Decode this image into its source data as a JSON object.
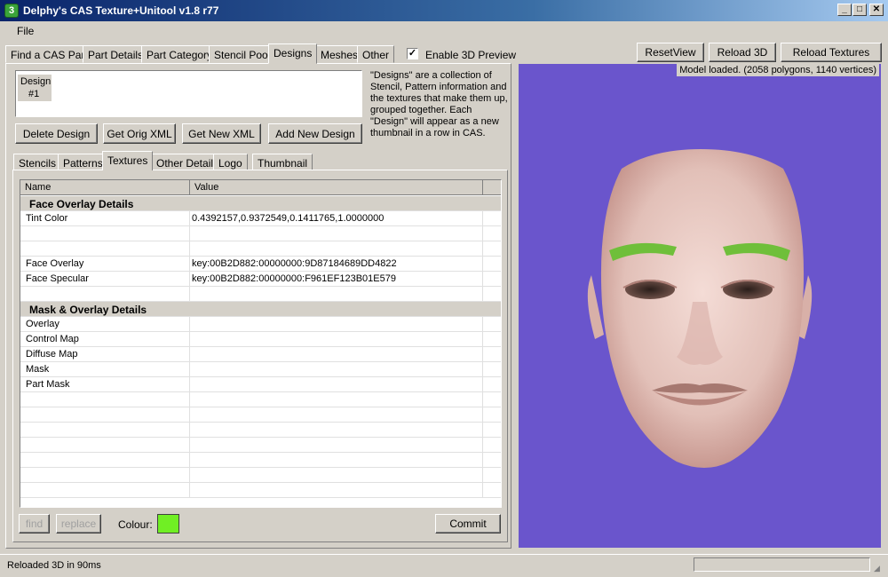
{
  "window": {
    "title": "Delphy's CAS Texture+Unitool v1.8 r77",
    "icon_glyph": "3",
    "controls": {
      "minimize": "_",
      "maximize": "□",
      "close": "✕"
    }
  },
  "menu": {
    "file": "File"
  },
  "main_tabs": [
    "Find a CAS Part",
    "Part Details",
    "Part Category",
    "Stencil Pool",
    "Designs",
    "Meshes",
    "Other"
  ],
  "enable_3d": {
    "label": "Enable 3D Preview",
    "checked": true,
    "check_glyph": "✓"
  },
  "toolbar_3d": {
    "reset_view": "ResetView",
    "reload_3d": "Reload 3D",
    "reload_textures": "Reload Textures"
  },
  "model_status": "Model loaded.  (2058 polygons, 1140 vertices)",
  "design_list": {
    "label": "Design",
    "item": "#1"
  },
  "design_help": "\"Designs\" are a collection of Stencil, Pattern information and the textures that make them up, grouped together.  Each \"Design\" will appear as a new thumbnail in a row in CAS.",
  "design_buttons": {
    "delete": "Delete Design",
    "get_orig": "Get Orig XML",
    "get_new": "Get New XML",
    "add_new": "Add New Design"
  },
  "sub_tabs": [
    "Stencils",
    "Patterns",
    "Textures",
    "Other Details",
    "Logo",
    "Thumbnail"
  ],
  "grid": {
    "headers": {
      "name": "Name",
      "value": "Value"
    },
    "category_1": "Face Overlay Details",
    "tint_color": {
      "name": "Tint Color",
      "value": "0.4392157,0.9372549,0.1411765,1.0000000"
    },
    "face_overlay": {
      "name": "Face Overlay",
      "value": "key:00B2D882:00000000:9D87184689DD4822"
    },
    "face_specular": {
      "name": "Face Specular",
      "value": "key:00B2D882:00000000:F961EF123B01E579"
    },
    "category_2": "Mask & Overlay Details",
    "overlay": {
      "name": "Overlay",
      "value": ""
    },
    "control_map": {
      "name": "Control Map",
      "value": ""
    },
    "diffuse_map": {
      "name": "Diffuse Map",
      "value": ""
    },
    "mask": {
      "name": "Mask",
      "value": ""
    },
    "part_mask": {
      "name": "Part Mask",
      "value": ""
    }
  },
  "bottom_controls": {
    "find": "find",
    "replace": "replace",
    "colour_label": "Colour:",
    "colour_value": "#70ef24",
    "commit": "Commit"
  },
  "status": "Reloaded 3D in 90ms",
  "colors": {
    "title_bar": "#0a246a",
    "viewport_bg": "#6a55cc",
    "eyebrows": "#6fbf3a"
  }
}
